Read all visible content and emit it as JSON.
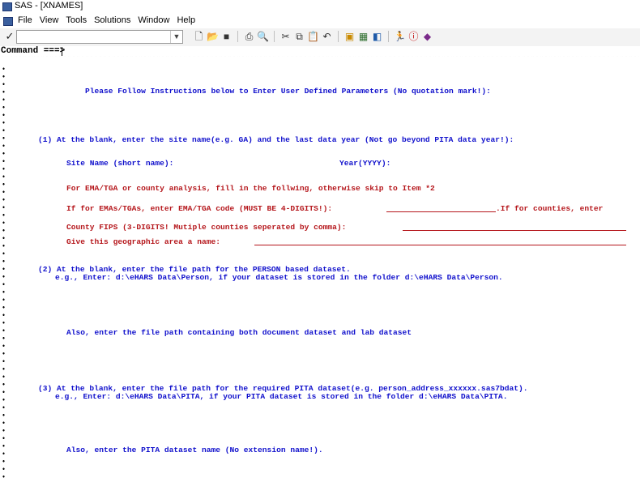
{
  "window": {
    "title": "SAS - [XNAMES]"
  },
  "menu": [
    "File",
    "View",
    "Tools",
    "Solutions",
    "Window",
    "Help"
  ],
  "toolbar": {
    "tools": [
      "new-icon",
      "open-icon",
      "save-icon",
      "print-icon",
      "print-preview-icon",
      "cut-icon",
      "copy-icon",
      "paste-icon",
      "undo-icon",
      "explorer-icon",
      "results-icon",
      "libraries-icon",
      "run-icon",
      "help-icon",
      "tutorial-icon"
    ]
  },
  "command": {
    "label": "Command ===>",
    "value": ""
  },
  "form": {
    "heading": "Please Follow Instructions below to Enter User Defined Parameters (No quotation mark!):",
    "item1": "(1) At the blank, enter the site name(e.g. GA) and the last data year (Not go beyond PITA data year!):",
    "site_label": "Site Name (short name):",
    "year_label": "Year(YYYY):",
    "ema_note": "For EMA/TGA or county analysis, fill in the follwing, otherwise skip to Item *2",
    "ema_label": "If for EMAs/TGAs, enter EMA/TGA code (MUST BE 4-DIGITS!):",
    "ema_tail": ".If for counties, enter",
    "county_label": "County FIPS (3-DIGITS! Mutiple counties seperated by comma):",
    "geo_label": "Give this geographic area a name:",
    "item2_line1": "(2) At the blank, enter the file path for the PERSON based dataset.",
    "item2_line2": "e.g., Enter: d:\\eHARS Data\\Person, if your dataset is stored in the folder d:\\eHARS Data\\Person.",
    "also1": "Also, enter the file path containing both document dataset and lab dataset",
    "item3_line1": "(3) At the blank, enter the file path for the required PITA dataset(e.g. person_address_xxxxxx.sas7bdat).",
    "item3_line2": "e.g., Enter: d:\\eHARS Data\\PITA, if your PITA dataset is stored in the folder d:\\eHARS Data\\PITA.",
    "also2": "Also, enter the PITA dataset name (No extension name!)."
  },
  "colors": {
    "label_blue": "#1010cc",
    "field_red": "#b5161b"
  }
}
